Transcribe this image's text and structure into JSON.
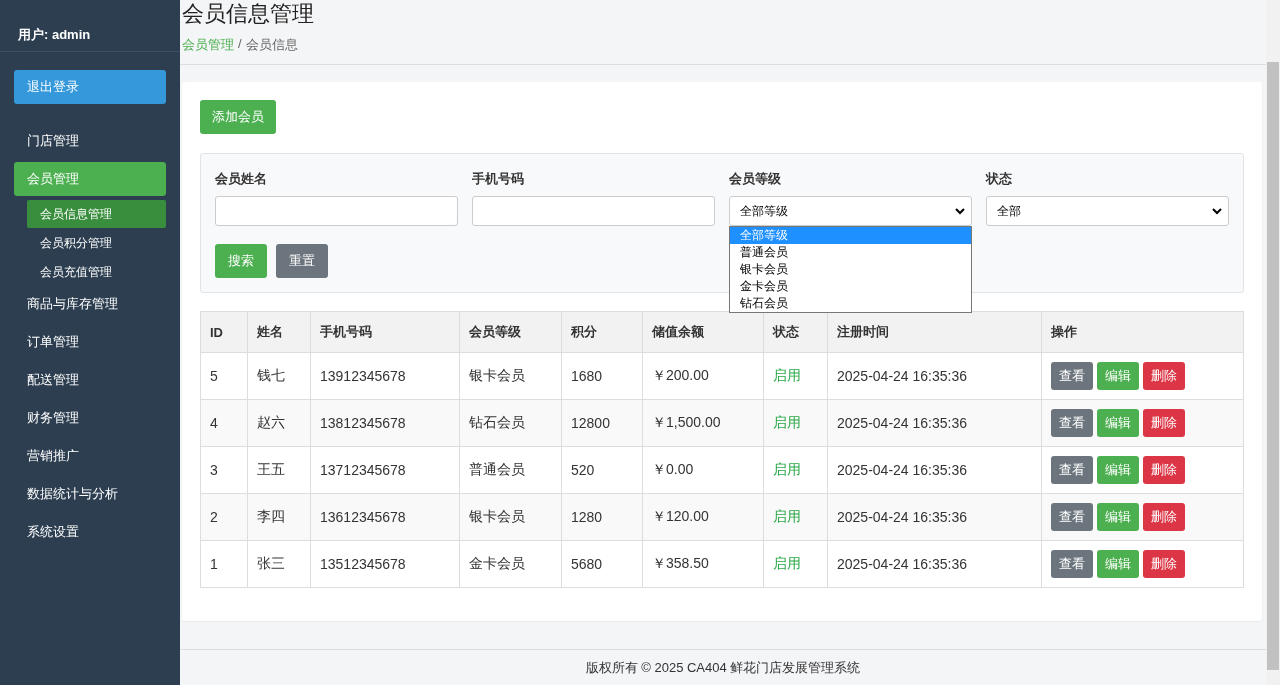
{
  "sidebar": {
    "user": "用户: admin",
    "logout": "退出登录",
    "items": [
      {
        "label": "门店管理",
        "selected": false
      },
      {
        "label": "会员管理",
        "selected": true,
        "children": [
          {
            "label": "会员信息管理",
            "selected": true
          },
          {
            "label": "会员积分管理",
            "selected": false
          },
          {
            "label": "会员充值管理",
            "selected": false
          }
        ]
      },
      {
        "label": "商品与库存管理",
        "selected": false
      },
      {
        "label": "订单管理",
        "selected": false
      },
      {
        "label": "配送管理",
        "selected": false
      },
      {
        "label": "财务管理",
        "selected": false
      },
      {
        "label": "营销推广",
        "selected": false
      },
      {
        "label": "数据统计与分析",
        "selected": false
      },
      {
        "label": "系统设置",
        "selected": false
      }
    ]
  },
  "header": {
    "title": "会员信息管理",
    "separator": "/",
    "breadcrumb": [
      {
        "label": "会员管理",
        "link": true
      },
      {
        "label": "会员信息",
        "link": false
      }
    ]
  },
  "add_button": "添加会员",
  "filters": [
    {
      "kind": "text",
      "label": "会员姓名"
    },
    {
      "kind": "text",
      "label": "手机号码"
    },
    {
      "kind": "select",
      "label": "会员等级",
      "value": "全部等级",
      "expanded": true,
      "options": [
        {
          "label": "全部等级",
          "selected": true
        },
        {
          "label": "普通会员",
          "selected": false
        },
        {
          "label": "银卡会员",
          "selected": false
        },
        {
          "label": "金卡会员",
          "selected": false
        },
        {
          "label": "钻石会员",
          "selected": false
        }
      ]
    },
    {
      "kind": "select",
      "label": "状态",
      "value": "全部",
      "expanded": false
    }
  ],
  "filter_buttons": [
    {
      "kind": "primary",
      "label": "搜索"
    },
    {
      "kind": "secondary",
      "label": "重置"
    }
  ],
  "table": {
    "columns": [
      "ID",
      "姓名",
      "手机号码",
      "会员等级",
      "积分",
      "储值余额",
      "状态",
      "注册时间",
      "操作"
    ],
    "rows": [
      {
        "cells": [
          "5",
          "钱七",
          "13912345678",
          "银卡会员",
          "1680",
          "￥200.00",
          "启用",
          "2025-04-24 16:35:36"
        ],
        "actions": [
          {
            "kind": "view",
            "label": "查看"
          },
          {
            "kind": "edit",
            "label": "编辑"
          },
          {
            "kind": "delete",
            "label": "删除"
          }
        ]
      },
      {
        "cells": [
          "4",
          "赵六",
          "13812345678",
          "钻石会员",
          "12800",
          "￥1,500.00",
          "启用",
          "2025-04-24 16:35:36"
        ],
        "actions": [
          {
            "kind": "view",
            "label": "查看"
          },
          {
            "kind": "edit",
            "label": "编辑"
          },
          {
            "kind": "delete",
            "label": "删除"
          }
        ]
      },
      {
        "cells": [
          "3",
          "王五",
          "13712345678",
          "普通会员",
          "520",
          "￥0.00",
          "启用",
          "2025-04-24 16:35:36"
        ],
        "actions": [
          {
            "kind": "view",
            "label": "查看"
          },
          {
            "kind": "edit",
            "label": "编辑"
          },
          {
            "kind": "delete",
            "label": "删除"
          }
        ]
      },
      {
        "cells": [
          "2",
          "李四",
          "13612345678",
          "银卡会员",
          "1280",
          "￥120.00",
          "启用",
          "2025-04-24 16:35:36"
        ],
        "actions": [
          {
            "kind": "view",
            "label": "查看"
          },
          {
            "kind": "edit",
            "label": "编辑"
          },
          {
            "kind": "delete",
            "label": "删除"
          }
        ]
      },
      {
        "cells": [
          "1",
          "张三",
          "13512345678",
          "金卡会员",
          "5680",
          "￥358.50",
          "启用",
          "2025-04-24 16:35:36"
        ],
        "actions": [
          {
            "kind": "view",
            "label": "查看"
          },
          {
            "kind": "edit",
            "label": "编辑"
          },
          {
            "kind": "delete",
            "label": "删除"
          }
        ]
      }
    ]
  },
  "footer": "版权所有 © 2025 CA404 鲜花门店发展管理系统"
}
